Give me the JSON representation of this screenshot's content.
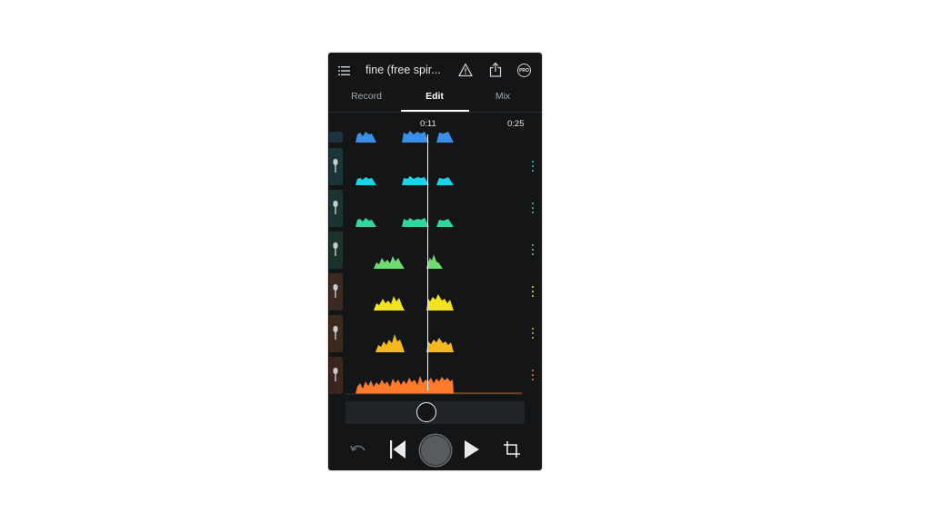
{
  "app": {
    "title": "fine (free spir...",
    "pro_badge": "PRO"
  },
  "tabs": [
    {
      "label": "Record",
      "active": false
    },
    {
      "label": "Edit",
      "active": true
    },
    {
      "label": "Mix",
      "active": false
    }
  ],
  "timeline": {
    "playhead_time": "0:11",
    "end_time": "0:25"
  },
  "tracks": [
    {
      "color": "#3a8fe6",
      "handle_color": "#1c3440"
    },
    {
      "color": "#18d4e6",
      "handle_color": "#1a3538"
    },
    {
      "color": "#2fd6a0",
      "handle_color": "#1b3331"
    },
    {
      "color": "#6fdc72",
      "handle_color": "#1d3228"
    },
    {
      "color": "#f2e41a",
      "handle_color": "#3a2a20"
    },
    {
      "color": "#f5b81f",
      "handle_color": "#3a2a1e"
    },
    {
      "color": "#ff7a2a",
      "handle_color": "#3a261c"
    }
  ],
  "icons": {
    "menu": "menu-icon",
    "warning": "warning-icon",
    "share": "share-icon",
    "undo": "undo-icon",
    "skip_back": "skip-back-icon",
    "record": "record-button",
    "play": "play-icon",
    "crop": "crop-icon"
  }
}
